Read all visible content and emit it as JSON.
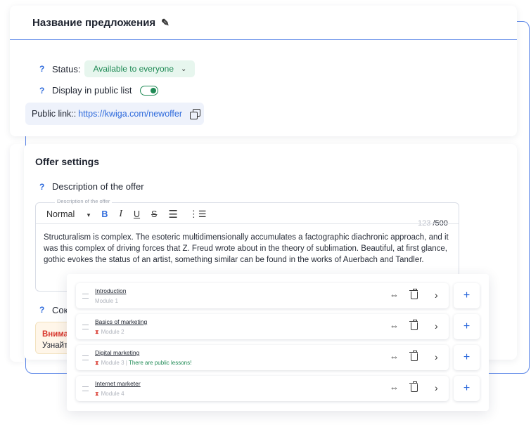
{
  "offer": {
    "title": "Название предложения",
    "status_label": "Status:",
    "status_value": "Available to everyone",
    "display_label": "Display in public list",
    "display_enabled": true,
    "public_link_label": "Public link::",
    "public_link_url": "https://kwiga.com/newoffer",
    "help_icon_char": "?"
  },
  "settings": {
    "title": "Offer settings",
    "description_label": "Description of the offer",
    "editor_legend": "Description of the offer",
    "toolbar": {
      "format": "Normal",
      "bold": "B",
      "italic": "I",
      "underline": "U",
      "strike": "S"
    },
    "char_count": "123",
    "char_max": "/500",
    "description_text": "Structuralism is complex. The esoteric multidimensionally accumulates a factographic diachronic approach, and it was this complex of driving forces that Z. Freud wrote about in the theory of sublimation. Beautiful, at first glance, gothic evokes the status of an artist, something similar can be found in the works of Auerbach and Tandler.",
    "truncated_row_label": "Сок",
    "warning_title": "Внима",
    "warning_text": "Узнайте"
  },
  "modules": [
    {
      "title": "Introduction",
      "subtitle": "Module 1",
      "hourglass": false,
      "public_note": ""
    },
    {
      "title": "Basics of marketing",
      "subtitle": "Module 2",
      "hourglass": true,
      "public_note": ""
    },
    {
      "title": "Digital marketing",
      "subtitle": "Module 3",
      "hourglass": true,
      "public_note": "There are public lessons!"
    },
    {
      "title": "Internet marketer",
      "subtitle": "Module 4",
      "hourglass": true,
      "public_note": ""
    }
  ],
  "colors": {
    "accent": "#2f6bdc",
    "success": "#1f8a55",
    "danger": "#d8352b",
    "border_highlight": "#5b86e8"
  },
  "icons": {
    "edit": "pencil-icon",
    "copy": "copy-icon",
    "drag": "drag-handle-icon",
    "move": "move-icon",
    "delete": "trash-icon",
    "open": "chevron-right-icon",
    "add": "plus-icon",
    "hourglass": "hourglass-icon"
  }
}
